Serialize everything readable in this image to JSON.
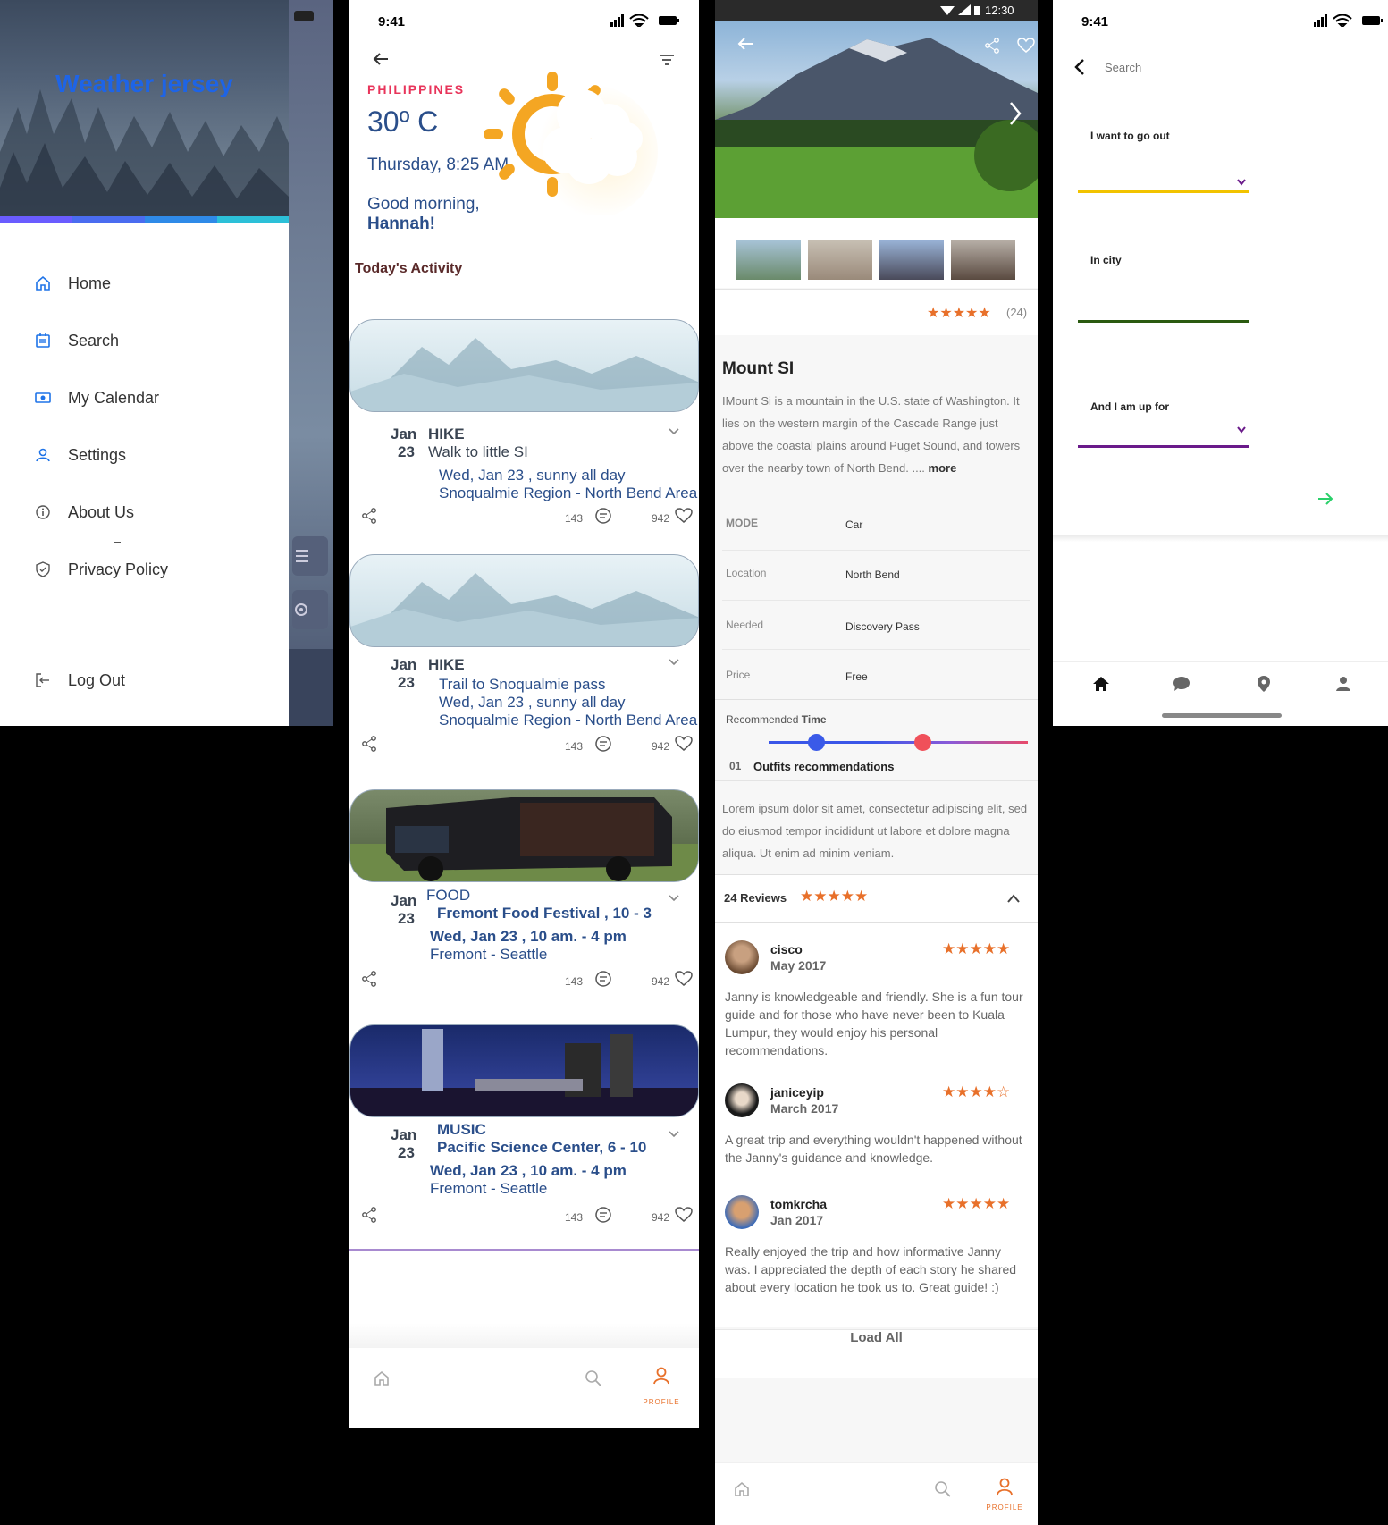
{
  "drawer": {
    "title": "Weather jersey",
    "items": [
      {
        "label": "Home"
      },
      {
        "label": "Search"
      },
      {
        "label": "My Calendar"
      },
      {
        "label": "Settings"
      },
      {
        "label": "About Us"
      },
      {
        "label": "Privacy Policy"
      }
    ],
    "logout": "Log Out",
    "progress_colors": [
      "#6a5cff",
      "#4a6cf0",
      "#2f8ae8",
      "#2cc0d8"
    ]
  },
  "weather": {
    "time": "9:41",
    "country": "PHILIPPINES",
    "temperature": "30º C",
    "datetime": "Thursday, 8:25 AM",
    "greeting": "Good morning,",
    "name": "Hannah!",
    "section_title": "Today's Activity",
    "cards": [
      {
        "month": "Jan",
        "day": "23",
        "category": "HIKE",
        "title": "Walk to little SI",
        "line1": "Wed, Jan 23 , sunny all day",
        "line2": "Snoqualmie Region - North Bend Area",
        "comments": "143",
        "likes": "942"
      },
      {
        "month": "Jan",
        "day": "23",
        "category": "HIKE",
        "title": "Trail to Snoqualmie pass",
        "line1": "Wed, Jan 23 , sunny all day",
        "line2": "Snoqualmie Region - North Bend Area",
        "comments": "143",
        "likes": "942"
      },
      {
        "month": "Jan",
        "day": "23",
        "category": "FOOD",
        "title": "Fremont Food Festival , 10 - 3",
        "line1": "Wed, Jan 23 , 10 am. - 4 pm",
        "line2": "Fremont - Seattle",
        "comments": "143",
        "likes": "942"
      },
      {
        "month": "Jan",
        "day": "23",
        "category": "MUSIC",
        "title": "Pacific Science Center, 6 - 10",
        "line1": "Wed, Jan 23 , 10 am. - 4 pm",
        "line2": "Fremont - Seattle",
        "comments": "143",
        "likes": "942"
      }
    ],
    "nav_profile": "PROFILE"
  },
  "detail": {
    "status_time": "12:30",
    "rating_count": "(24)",
    "stars": "★★★★★",
    "title": "Mount SI",
    "description": "IMount Si is a mountain in the U.S. state of Washington. It lies on the western margin of the Cascade Range just above the coastal plains around Puget Sound, and towers over the nearby town of North Bend. ....",
    "more": "more",
    "info": [
      {
        "label": "MODE",
        "value": "Car"
      },
      {
        "label": "Location",
        "value": "North Bend"
      },
      {
        "label": "Needed",
        "value": "Discovery Pass"
      },
      {
        "label": "Price",
        "value": "Free"
      }
    ],
    "recommended_label": "Recommended",
    "recommended_time": "Time",
    "outfits_num": "01",
    "outfits_title": "Outfits recommendations",
    "lorem": "Lorem ipsum dolor sit amet, consectetur adipiscing elit, sed do eiusmod tempor incididunt ut labore et dolore magna aliqua. Ut enim ad minim veniam.",
    "reviews_title": "24 Reviews",
    "reviews": [
      {
        "name": "cisco",
        "date": "May 2017",
        "stars": "★★★★★",
        "text": "Janny is knowledgeable and friendly. She is a fun tour guide and for those who have never been to Kuala Lumpur, they would enjoy his personal recommendations."
      },
      {
        "name": "janiceyip",
        "date": "March 2017",
        "stars": "★★★★☆",
        "text": "A great trip and everything wouldn't happened without the Janny's guidance and knowledge."
      },
      {
        "name": "tomkrcha",
        "date": "Jan 2017",
        "stars": "★★★★★",
        "text": "Really enjoyed the trip and how informative Janny was. I appreciated the depth of each story he shared about every location he took us to. Great guide! :)"
      }
    ],
    "load_all": "Load All",
    "nav_profile": "PROFILE"
  },
  "search": {
    "time": "9:41",
    "placeholder": "Search",
    "fields": [
      {
        "label": "I want to go out",
        "color": "#f2c300"
      },
      {
        "label": "In city",
        "color": "#2a5a10"
      },
      {
        "label": "And I am up for",
        "color": "#6a1a8a"
      }
    ]
  }
}
